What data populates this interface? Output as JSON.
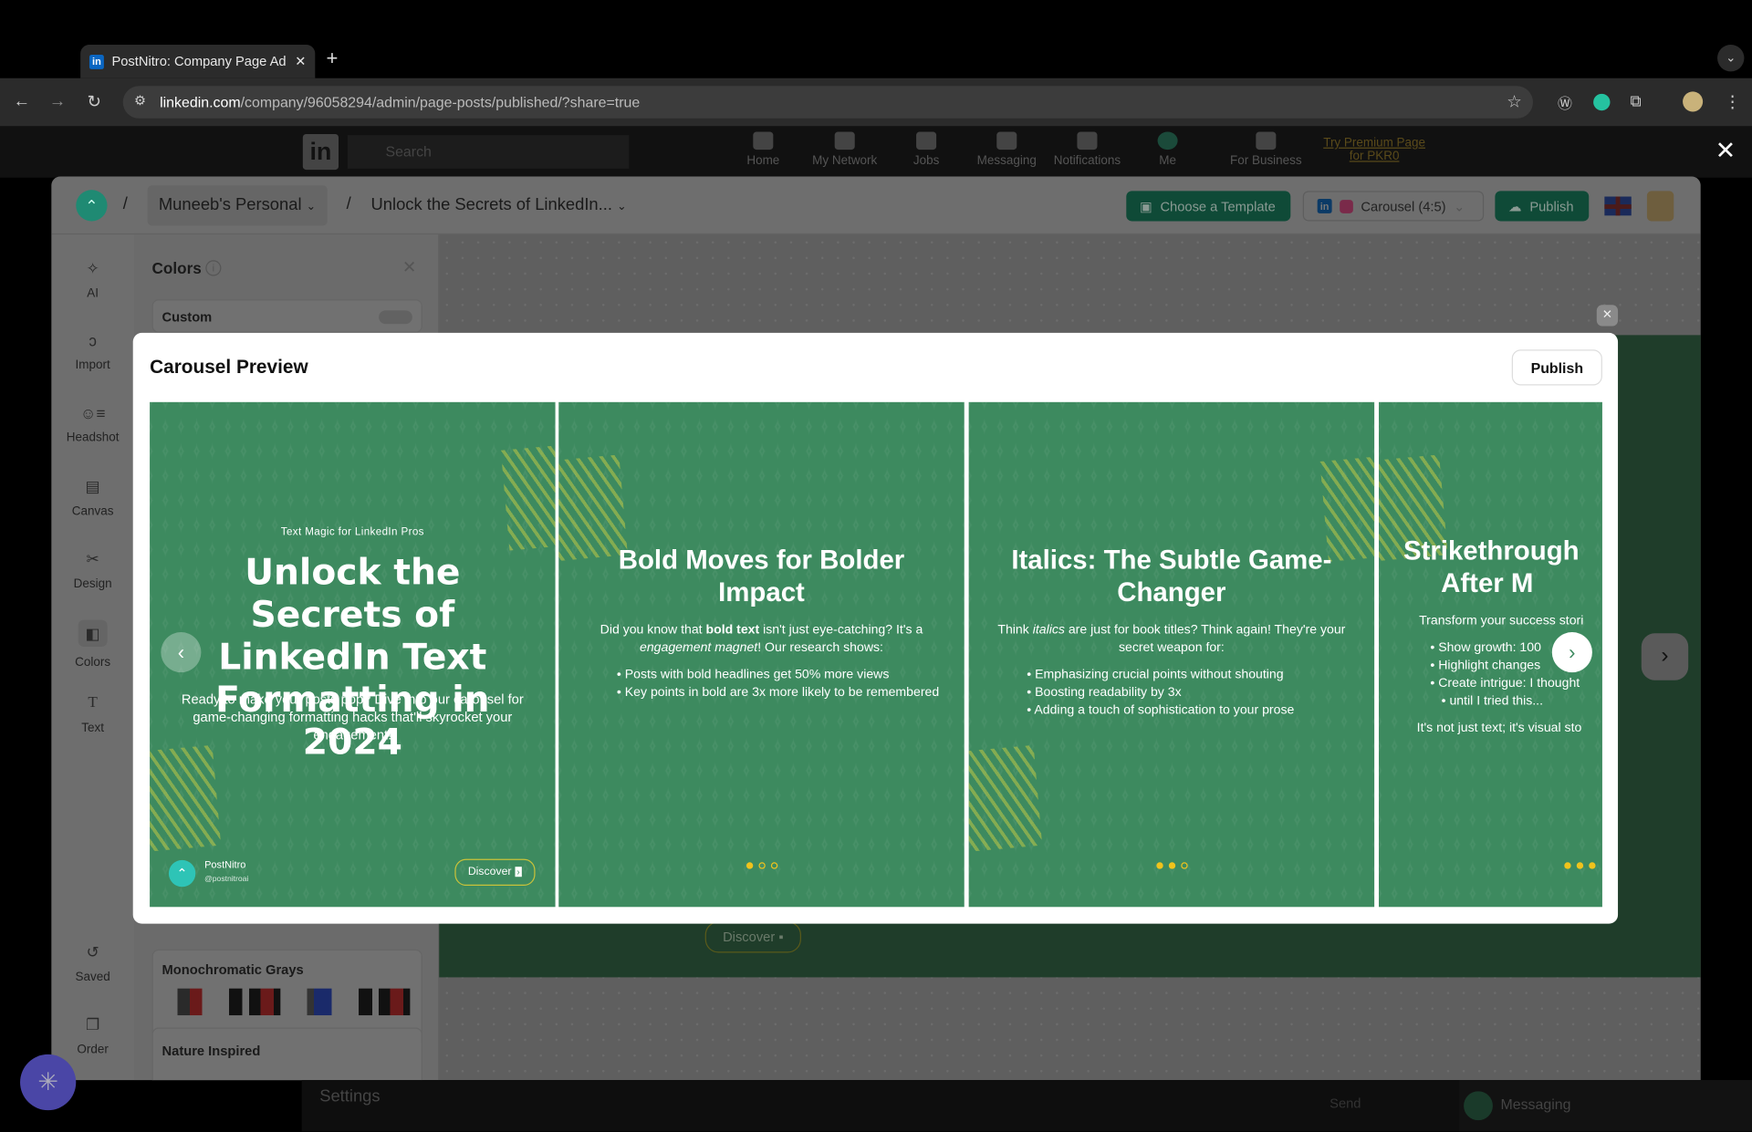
{
  "browser": {
    "tab_title": "PostNitro: Company Page Ad",
    "url_domain": "linkedin.com",
    "url_path": "/company/96058294/admin/page-posts/published/?share=true"
  },
  "linkedin_nav": {
    "search_placeholder": "Search",
    "items": [
      "Home",
      "My Network",
      "Jobs",
      "Messaging",
      "Notifications",
      "Me",
      "For Business"
    ],
    "premium": "Try Premium Page for PKR0",
    "messaging": "Messaging",
    "settings": "Settings",
    "send": "Send"
  },
  "app": {
    "workspace": "Muneeb's Personal",
    "document": "Unlock the Secrets of LinkedIn...",
    "choose_template": "Choose a Template",
    "format": "Carousel (4:5)",
    "publish": "Publish",
    "rail": [
      "AI",
      "Import",
      "Headshot",
      "Canvas",
      "Design",
      "Colors",
      "Text",
      "Saved",
      "Order"
    ],
    "panel": {
      "title": "Colors",
      "custom": "Custom",
      "palettes": [
        "Monochromatic Grays",
        "Nature Inspired"
      ]
    },
    "bg_discover": "Discover"
  },
  "modal": {
    "title": "Carousel Preview",
    "publish": "Publish",
    "slides": [
      {
        "kicker": "Text Magic for LinkedIn Pros",
        "title": "Unlock the Secrets of LinkedIn Text Formatting in 2024",
        "body": "Ready to make your posts pop? Dive into our carousel for game-changing formatting hacks that'll skyrocket your engagement!",
        "brand": "PostNitro",
        "handle": "@postnitroai",
        "cta": "Discover"
      },
      {
        "title": "Bold Moves for Bolder Impact",
        "body_a": "Did you know that ",
        "body_b": "bold text",
        "body_c": " isn't just eye-catching? It's a ",
        "body_d": "engagement magnet",
        "body_e": "! Our research shows:",
        "bullets": [
          "Posts with bold headlines get 50% more views",
          "Key points in bold are 3x more likely to be remembered"
        ]
      },
      {
        "title": "Italics: The Subtle Game-Changer",
        "body_a": "Think ",
        "body_b": "italics",
        "body_c": " are just for book titles? Think again! They're your secret weapon for:",
        "bullets": [
          "Emphasizing crucial points without shouting",
          "Boosting readability by 3x",
          "Adding a touch of sophistication to your prose"
        ]
      },
      {
        "title": "Strikethrough After M",
        "body": "Transform your success stori",
        "bullets": [
          "Show growth: 100",
          "Highlight changes",
          "Create intrigue: I thought",
          "until I tried this..."
        ],
        "footer": "It's not just text; it's visual sto"
      }
    ],
    "colors": {
      "slide_bg": "#3d8a5f",
      "accent": "#f0c31c"
    }
  }
}
